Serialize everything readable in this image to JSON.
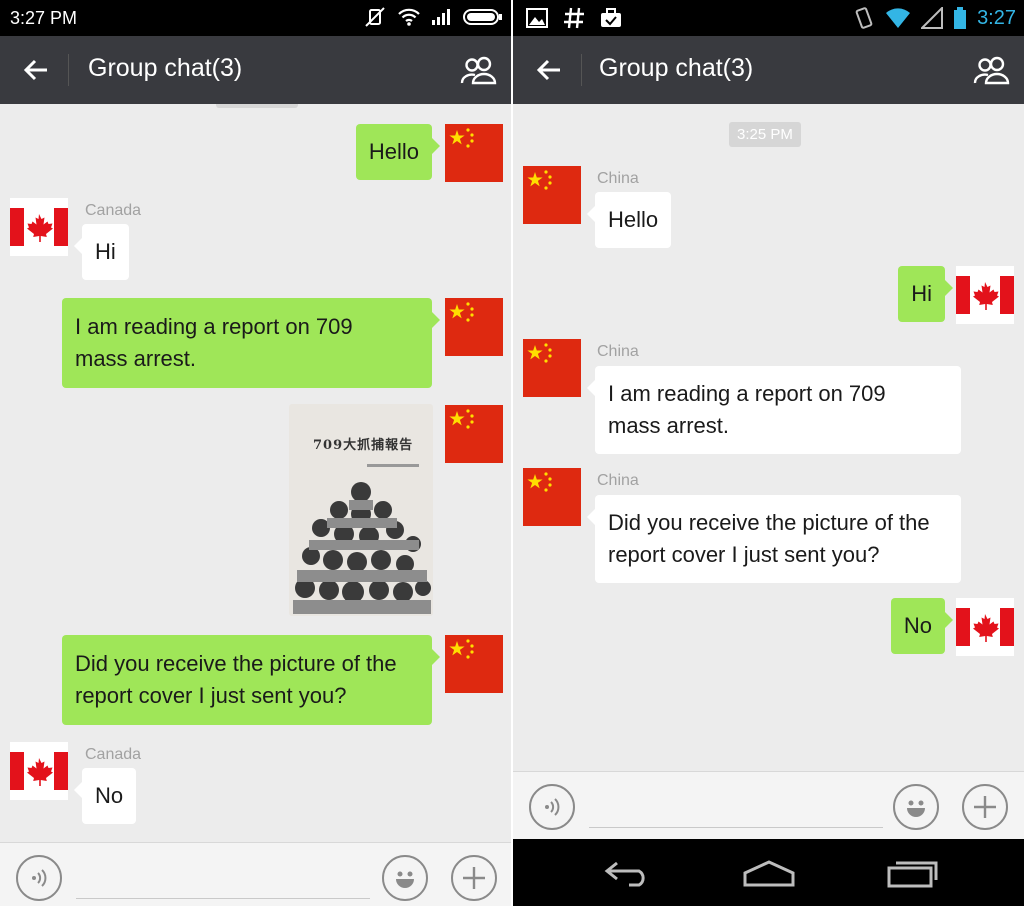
{
  "left_phone": {
    "status_time": "3:27 PM",
    "title": "Group chat(3)",
    "messages": [
      {
        "sender": "",
        "text": "Hello"
      },
      {
        "sender": "Canada",
        "text": "Hi"
      },
      {
        "sender": "",
        "text_line1": "I am reading a report on 709",
        "text_line2": "mass arrest."
      },
      {
        "sender": "",
        "image": "report-cover-photo",
        "image_title": "709大抓捕報告"
      },
      {
        "sender": "",
        "text_line1": "Did you receive the picture of the",
        "text_line2": "report cover I just sent you?"
      },
      {
        "sender": "Canada",
        "text": "No"
      }
    ]
  },
  "right_phone": {
    "status_time": "3:27",
    "title": "Group chat(3)",
    "timestamp": "3:25 PM",
    "messages": [
      {
        "sender": "China",
        "text": "Hello"
      },
      {
        "sender": "",
        "text": "Hi"
      },
      {
        "sender": "China",
        "text_line1": "I am reading a report on 709",
        "text_line2": "mass arrest."
      },
      {
        "sender": "China",
        "text_line1": "Did you receive the picture of the",
        "text_line2": "report cover I just sent you?"
      },
      {
        "sender": "",
        "text": "No"
      }
    ]
  },
  "colors": {
    "titlebar": "#393a3f",
    "bubble_sent": "#9fe658",
    "bubble_received": "#ffffff",
    "background": "#ececec",
    "status_accent": "#33b5e5"
  },
  "icons": [
    "back-arrow-icon",
    "group-members-icon",
    "voice-icon",
    "emoji-icon",
    "plus-icon",
    "wifi-icon",
    "signal-icon",
    "battery-icon",
    "china-flag-icon",
    "canada-flag-icon"
  ]
}
